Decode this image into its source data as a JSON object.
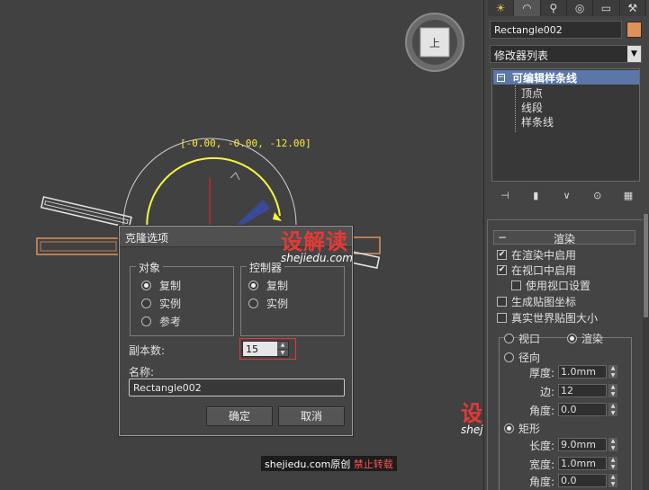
{
  "viewport": {
    "coord_readout": "[-0.00, -0.00, -12.00]",
    "viewcube_label": "上"
  },
  "clone_dialog": {
    "title": "克隆选项",
    "object_group": {
      "legend": "对象",
      "options": [
        {
          "label": "复制",
          "selected": true
        },
        {
          "label": "实例",
          "selected": false
        },
        {
          "label": "参考",
          "selected": false
        }
      ]
    },
    "controller_group": {
      "legend": "控制器",
      "options": [
        {
          "label": "复制",
          "selected": true
        },
        {
          "label": "实例",
          "selected": false
        }
      ]
    },
    "copies_label": "副本数:",
    "copies_value": "15",
    "name_label": "名称:",
    "name_value": "Rectangle002",
    "ok_label": "确定",
    "cancel_label": "取消"
  },
  "watermarks": {
    "brand": "设解读",
    "url": "shejiedu.com",
    "footer_site": "shejiedu.com原创",
    "footer_warning": "禁止转载"
  },
  "command_panel": {
    "tabs": [
      "☀",
      "◠",
      "⚲",
      "◎",
      "▭",
      "⚒"
    ],
    "object_name": "Rectangle002",
    "object_color": "#e0905a",
    "modifier_list_label": "修改器列表",
    "stack": {
      "root": "可编辑样条线",
      "expand_glyph": "−",
      "children": [
        "顶点",
        "线段",
        "样条线"
      ]
    },
    "tool_icons": [
      "⊣",
      "▮",
      "∨",
      "⊙",
      "▦"
    ],
    "render_rollout": {
      "collapse_glyph": "−",
      "title": "渲染",
      "checkboxes": [
        {
          "label": "在渲染中启用",
          "checked": true
        },
        {
          "label": "在视口中启用",
          "checked": true
        },
        {
          "label": "使用视口设置",
          "checked": false
        },
        {
          "label": "生成贴图坐标",
          "checked": false
        },
        {
          "label": "真实世界贴图大小",
          "checked": false
        }
      ],
      "viewport_radio": "视口",
      "render_radio": "渲染",
      "radial_label": "径向",
      "thickness_label": "厚度:",
      "thickness_value": "1.0mm",
      "sides_label": "边:",
      "sides_value": "12",
      "angle_label": "角度:",
      "angle_value": "0.0",
      "rect_label": "矩形",
      "length_label": "长度:",
      "length_value": "9.0mm",
      "width_label": "宽度:",
      "width_value": "1.0mm",
      "angle2_label": "角度:",
      "angle2_value": "0.0"
    }
  }
}
